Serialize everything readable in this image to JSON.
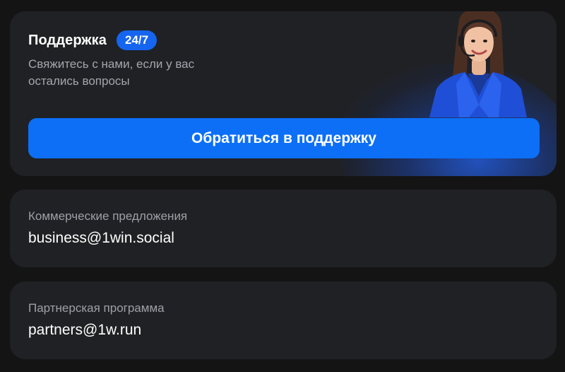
{
  "support": {
    "title": "Поддержка",
    "badge": "24/7",
    "subtitle_line1": "Свяжитесь с нами, если у вас",
    "subtitle_line2": "остались вопросы",
    "button_label": "Обратиться в поддержку"
  },
  "contacts": [
    {
      "label": "Коммерческие предложения",
      "value": "business@1win.social"
    },
    {
      "label": "Партнерская программа",
      "value": "partners@1w.run"
    }
  ],
  "colors": {
    "background": "#141414",
    "card": "#202124",
    "accent": "#0c6ff6",
    "badge": "#1565f0",
    "muted_text": "#a3a6ad"
  },
  "icons": {
    "support_agent": "support-agent-illustration"
  }
}
